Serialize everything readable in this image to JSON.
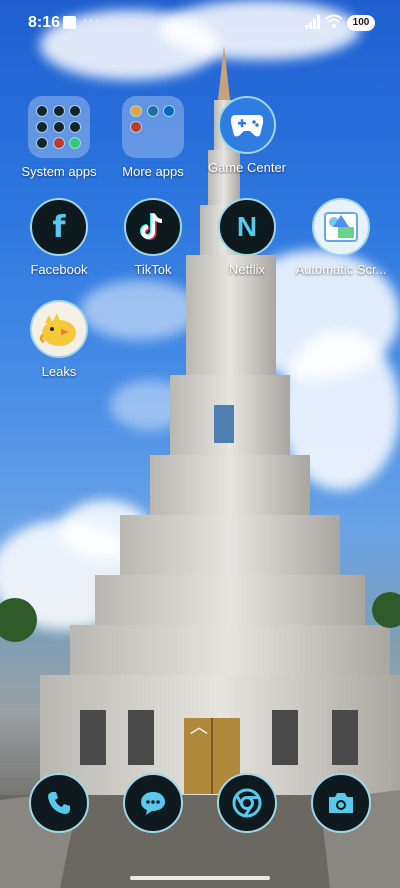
{
  "status_bar": {
    "time": "8:16",
    "battery": "100"
  },
  "apps": [
    {
      "label": "System apps",
      "icon": "folder-icon"
    },
    {
      "label": "More apps",
      "icon": "folder-icon"
    },
    {
      "label": "Game Center",
      "icon": "gamepad-icon"
    },
    {
      "label": "Facebook",
      "icon": "facebook-icon"
    },
    {
      "label": "TikTok",
      "icon": "tiktok-icon"
    },
    {
      "label": "Netflix",
      "icon": "netflix-icon"
    },
    {
      "label": "Automatic Scr...",
      "icon": "screenshot-icon"
    },
    {
      "label": "Leaks",
      "icon": "bird-icon"
    }
  ],
  "dock": [
    {
      "icon": "phone-icon"
    },
    {
      "icon": "messages-icon"
    },
    {
      "icon": "chrome-icon"
    },
    {
      "icon": "camera-icon"
    }
  ],
  "colors": {
    "icon_ring": "#9fd6e6",
    "icon_bg": "#0f1a1f",
    "accent": "#58c9ec"
  }
}
